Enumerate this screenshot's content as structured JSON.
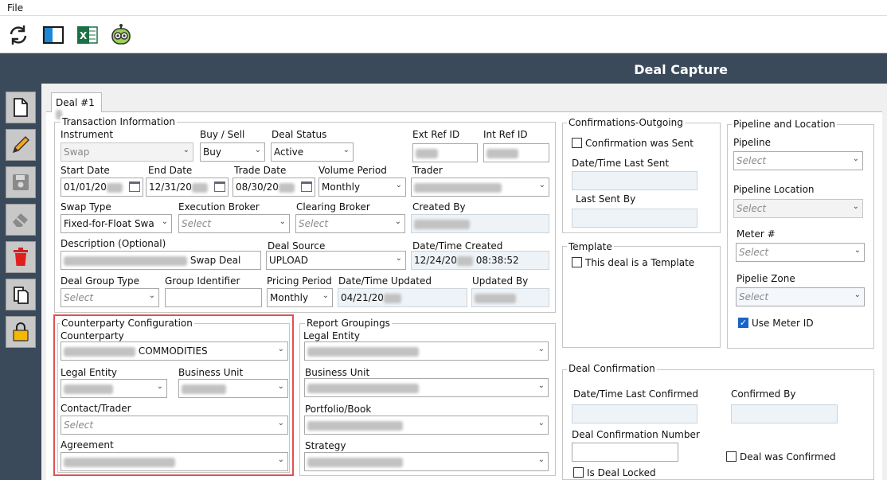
{
  "menu": {
    "file": "File"
  },
  "toolbar": {
    "icons": [
      "refresh-icon",
      "panel-icon",
      "excel-icon",
      "robot-icon"
    ]
  },
  "header": {
    "title": "Deal Capture"
  },
  "nav": {
    "icons": [
      "new-document-icon",
      "edit-pencil-icon",
      "save-disk-icon",
      "eraser-icon",
      "delete-trash-icon",
      "copy-icon",
      "lock-icon"
    ]
  },
  "tab": {
    "label": "Deal #1"
  },
  "transaction": {
    "legend": "Transaction Information",
    "instrument_label": "Instrument",
    "instrument_value": "Swap",
    "buysell_label": "Buy / Sell",
    "buysell_value": "Buy",
    "dealstatus_label": "Deal Status",
    "dealstatus_value": "Active",
    "extref_label": "Ext Ref ID",
    "intref_label": "Int Ref ID",
    "startdate_label": "Start Date",
    "startdate_value": "01/01/20",
    "enddate_label": "End Date",
    "enddate_value": "12/31/20",
    "tradedate_label": "Trade Date",
    "tradedate_value": "08/30/20",
    "volperiod_label": "Volume Period",
    "volperiod_value": "Monthly",
    "trader_label": "Trader",
    "swaptype_label": "Swap Type",
    "swaptype_value": "Fixed-for-Float Swa",
    "execbroker_label": "Execution Broker",
    "execbroker_value": "Select",
    "clearbroker_label": "Clearing Broker",
    "clearbroker_value": "Select",
    "createdby_label": "Created By",
    "desc_label": "Description (Optional)",
    "desc_value": "Swap Deal",
    "dealsource_label": "Deal Source",
    "dealsource_value": "UPLOAD",
    "created_label": "Date/Time Created",
    "created_date": "12/24/20",
    "created_time": "08:38:52",
    "grouptype_label": "Deal Group Type",
    "grouptype_value": "Select",
    "groupid_label": "Group Identifier",
    "pricingperiod_label": "Pricing Period",
    "pricingperiod_value": "Monthly",
    "updated_label": "Date/Time Updated",
    "updated_value": "04/21/20",
    "updatedby_label": "Updated By"
  },
  "counterparty": {
    "legend": "Counterparty Configuration",
    "counterparty_label": "Counterparty",
    "counterparty_value": "COMMODITIES",
    "legalentity_label": "Legal Entity",
    "businessunit_label": "Business Unit",
    "contact_label": "Contact/Trader",
    "contact_value": "Select",
    "agreement_label": "Agreement"
  },
  "report": {
    "legend": "Report Groupings",
    "legalentity_label": "Legal Entity",
    "businessunit_label": "Business Unit",
    "portfolio_label": "Portfolio/Book",
    "strategy_label": "Strategy"
  },
  "confirmations": {
    "legend": "Confirmations-Outgoing",
    "sent_label": "Confirmation was Sent",
    "lastsent_label": "Date/Time Last Sent",
    "lastsentby_label": "Last Sent By"
  },
  "template": {
    "legend": "Template",
    "template_label": "This deal is a Template"
  },
  "pipeline": {
    "legend": "Pipeline and Location",
    "pipeline_label": "Pipeline",
    "pipeline_value": "Select",
    "location_label": "Pipeline Location",
    "location_value": "Select",
    "meter_label": "Meter #",
    "meter_value": "Select",
    "zone_label": "Pipelie  Zone",
    "zone_value": "Select",
    "usemeter_label": "Use Meter ID"
  },
  "dealconfirm": {
    "legend": "Deal Confirmation",
    "lastconfirmed_label": "Date/Time Last Confirmed",
    "confirmedby_label": "Confirmed By",
    "number_label": "Deal Confirmation Number",
    "wasconfirmed_label": "Deal was Confirmed",
    "locked_label": "Is Deal Locked"
  }
}
